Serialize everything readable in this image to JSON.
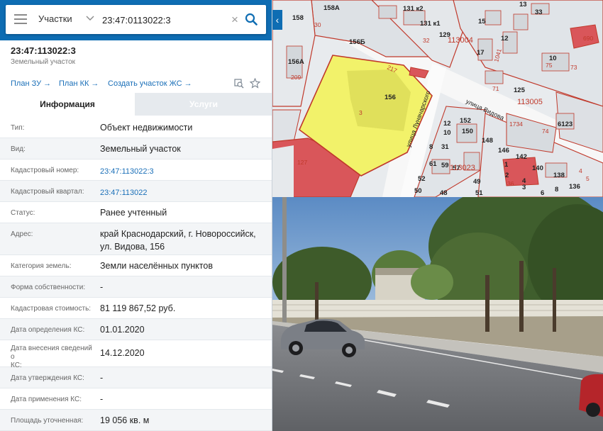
{
  "search": {
    "type_label": "Участки",
    "value": "23:47:0113022:3"
  },
  "object": {
    "title": "23:47:113022:3",
    "subtitle": "Земельный участок"
  },
  "links": {
    "plan_zu": "План ЗУ",
    "plan_kk": "План КК",
    "create_zhs": "Создать участок ЖС",
    "arrow": "→"
  },
  "tabs": {
    "info": "Информация",
    "services": "Услуги"
  },
  "rows": [
    {
      "label": "Тип:",
      "value": "Объект недвижимости"
    },
    {
      "label": "Вид:",
      "value": "Земельный участок"
    },
    {
      "label": "Кадастровый номер:",
      "value": "23:47:113022:3"
    },
    {
      "label": "Кадастровый квартал:",
      "value": "23:47:113022"
    },
    {
      "label": "Статус:",
      "value": "Ранее учтенный"
    },
    {
      "label": "Адрес:",
      "value_lines": [
        "край Краснодарский, г. Новороссийск,",
        "ул. Видова, 156"
      ]
    },
    {
      "label": "Категория земель:",
      "value": "Земли населённых пунктов"
    },
    {
      "label": "Форма собственности:",
      "value": "-"
    },
    {
      "label": "Кадастровая стоимость:",
      "value": "81 119 867,52 руб."
    },
    {
      "label": "Дата определения КС:",
      "value": "01.01.2020"
    },
    {
      "label_lines": [
        "Дата внесения сведений о",
        "КС:"
      ],
      "value": "14.12.2020"
    },
    {
      "label": "Дата утверждения КС:",
      "value": "-"
    },
    {
      "label": "Дата применения КС:",
      "value": "-"
    },
    {
      "label": "Площадь уточненная:",
      "value": "19 056 кв. м"
    }
  ],
  "map": {
    "parcel_number": "156",
    "parcel_part": "3",
    "street_lunacharskogo": "улица Луначарского",
    "street_vidova": "улица Видова",
    "quarter_1": "113004",
    "quarter_2": "113005",
    "quarter_3": "113023",
    "labels": [
      "158",
      "158А",
      "131 к2",
      "131 к1",
      "129",
      "15",
      "13",
      "33",
      "156Б",
      "156А",
      "17",
      "12",
      "10",
      "125",
      "6123",
      "152",
      "150",
      "148",
      "146",
      "142",
      "140",
      "138",
      "136",
      "10",
      "31",
      "61",
      "59",
      "57",
      "52",
      "50",
      "48",
      "4",
      "3",
      "8",
      "6",
      "49",
      "51",
      "1",
      "2"
    ],
    "red_labels": [
      "30",
      "209",
      "217",
      "127",
      "1041",
      "71",
      "75",
      "73",
      "74",
      "1734",
      "4",
      "5",
      "32",
      "690",
      "36"
    ],
    "colors": {
      "parcel_fill": "#f2f26a",
      "parcel_border": "#c0392b",
      "building": "#d9dcdf",
      "red_building": "#d9565a"
    }
  }
}
